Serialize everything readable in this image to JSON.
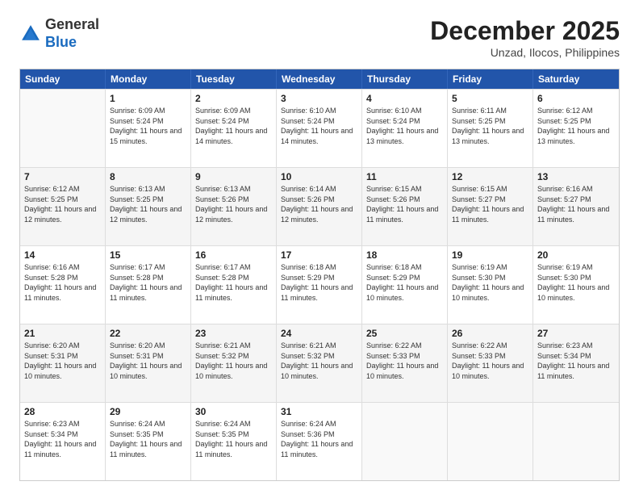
{
  "logo": {
    "general": "General",
    "blue": "Blue"
  },
  "title": "December 2025",
  "subtitle": "Unzad, Ilocos, Philippines",
  "header": {
    "days": [
      "Sunday",
      "Monday",
      "Tuesday",
      "Wednesday",
      "Thursday",
      "Friday",
      "Saturday"
    ]
  },
  "weeks": [
    [
      {
        "day": "",
        "sunrise": "",
        "sunset": "",
        "daylight": ""
      },
      {
        "day": "1",
        "sunrise": "Sunrise: 6:09 AM",
        "sunset": "Sunset: 5:24 PM",
        "daylight": "Daylight: 11 hours and 15 minutes."
      },
      {
        "day": "2",
        "sunrise": "Sunrise: 6:09 AM",
        "sunset": "Sunset: 5:24 PM",
        "daylight": "Daylight: 11 hours and 14 minutes."
      },
      {
        "day": "3",
        "sunrise": "Sunrise: 6:10 AM",
        "sunset": "Sunset: 5:24 PM",
        "daylight": "Daylight: 11 hours and 14 minutes."
      },
      {
        "day": "4",
        "sunrise": "Sunrise: 6:10 AM",
        "sunset": "Sunset: 5:24 PM",
        "daylight": "Daylight: 11 hours and 13 minutes."
      },
      {
        "day": "5",
        "sunrise": "Sunrise: 6:11 AM",
        "sunset": "Sunset: 5:25 PM",
        "daylight": "Daylight: 11 hours and 13 minutes."
      },
      {
        "day": "6",
        "sunrise": "Sunrise: 6:12 AM",
        "sunset": "Sunset: 5:25 PM",
        "daylight": "Daylight: 11 hours and 13 minutes."
      }
    ],
    [
      {
        "day": "7",
        "sunrise": "Sunrise: 6:12 AM",
        "sunset": "Sunset: 5:25 PM",
        "daylight": "Daylight: 11 hours and 12 minutes."
      },
      {
        "day": "8",
        "sunrise": "Sunrise: 6:13 AM",
        "sunset": "Sunset: 5:25 PM",
        "daylight": "Daylight: 11 hours and 12 minutes."
      },
      {
        "day": "9",
        "sunrise": "Sunrise: 6:13 AM",
        "sunset": "Sunset: 5:26 PM",
        "daylight": "Daylight: 11 hours and 12 minutes."
      },
      {
        "day": "10",
        "sunrise": "Sunrise: 6:14 AM",
        "sunset": "Sunset: 5:26 PM",
        "daylight": "Daylight: 11 hours and 12 minutes."
      },
      {
        "day": "11",
        "sunrise": "Sunrise: 6:15 AM",
        "sunset": "Sunset: 5:26 PM",
        "daylight": "Daylight: 11 hours and 11 minutes."
      },
      {
        "day": "12",
        "sunrise": "Sunrise: 6:15 AM",
        "sunset": "Sunset: 5:27 PM",
        "daylight": "Daylight: 11 hours and 11 minutes."
      },
      {
        "day": "13",
        "sunrise": "Sunrise: 6:16 AM",
        "sunset": "Sunset: 5:27 PM",
        "daylight": "Daylight: 11 hours and 11 minutes."
      }
    ],
    [
      {
        "day": "14",
        "sunrise": "Sunrise: 6:16 AM",
        "sunset": "Sunset: 5:28 PM",
        "daylight": "Daylight: 11 hours and 11 minutes."
      },
      {
        "day": "15",
        "sunrise": "Sunrise: 6:17 AM",
        "sunset": "Sunset: 5:28 PM",
        "daylight": "Daylight: 11 hours and 11 minutes."
      },
      {
        "day": "16",
        "sunrise": "Sunrise: 6:17 AM",
        "sunset": "Sunset: 5:28 PM",
        "daylight": "Daylight: 11 hours and 11 minutes."
      },
      {
        "day": "17",
        "sunrise": "Sunrise: 6:18 AM",
        "sunset": "Sunset: 5:29 PM",
        "daylight": "Daylight: 11 hours and 11 minutes."
      },
      {
        "day": "18",
        "sunrise": "Sunrise: 6:18 AM",
        "sunset": "Sunset: 5:29 PM",
        "daylight": "Daylight: 11 hours and 10 minutes."
      },
      {
        "day": "19",
        "sunrise": "Sunrise: 6:19 AM",
        "sunset": "Sunset: 5:30 PM",
        "daylight": "Daylight: 11 hours and 10 minutes."
      },
      {
        "day": "20",
        "sunrise": "Sunrise: 6:19 AM",
        "sunset": "Sunset: 5:30 PM",
        "daylight": "Daylight: 11 hours and 10 minutes."
      }
    ],
    [
      {
        "day": "21",
        "sunrise": "Sunrise: 6:20 AM",
        "sunset": "Sunset: 5:31 PM",
        "daylight": "Daylight: 11 hours and 10 minutes."
      },
      {
        "day": "22",
        "sunrise": "Sunrise: 6:20 AM",
        "sunset": "Sunset: 5:31 PM",
        "daylight": "Daylight: 11 hours and 10 minutes."
      },
      {
        "day": "23",
        "sunrise": "Sunrise: 6:21 AM",
        "sunset": "Sunset: 5:32 PM",
        "daylight": "Daylight: 11 hours and 10 minutes."
      },
      {
        "day": "24",
        "sunrise": "Sunrise: 6:21 AM",
        "sunset": "Sunset: 5:32 PM",
        "daylight": "Daylight: 11 hours and 10 minutes."
      },
      {
        "day": "25",
        "sunrise": "Sunrise: 6:22 AM",
        "sunset": "Sunset: 5:33 PM",
        "daylight": "Daylight: 11 hours and 10 minutes."
      },
      {
        "day": "26",
        "sunrise": "Sunrise: 6:22 AM",
        "sunset": "Sunset: 5:33 PM",
        "daylight": "Daylight: 11 hours and 10 minutes."
      },
      {
        "day": "27",
        "sunrise": "Sunrise: 6:23 AM",
        "sunset": "Sunset: 5:34 PM",
        "daylight": "Daylight: 11 hours and 11 minutes."
      }
    ],
    [
      {
        "day": "28",
        "sunrise": "Sunrise: 6:23 AM",
        "sunset": "Sunset: 5:34 PM",
        "daylight": "Daylight: 11 hours and 11 minutes."
      },
      {
        "day": "29",
        "sunrise": "Sunrise: 6:24 AM",
        "sunset": "Sunset: 5:35 PM",
        "daylight": "Daylight: 11 hours and 11 minutes."
      },
      {
        "day": "30",
        "sunrise": "Sunrise: 6:24 AM",
        "sunset": "Sunset: 5:35 PM",
        "daylight": "Daylight: 11 hours and 11 minutes."
      },
      {
        "day": "31",
        "sunrise": "Sunrise: 6:24 AM",
        "sunset": "Sunset: 5:36 PM",
        "daylight": "Daylight: 11 hours and 11 minutes."
      },
      {
        "day": "",
        "sunrise": "",
        "sunset": "",
        "daylight": ""
      },
      {
        "day": "",
        "sunrise": "",
        "sunset": "",
        "daylight": ""
      },
      {
        "day": "",
        "sunrise": "",
        "sunset": "",
        "daylight": ""
      }
    ]
  ]
}
